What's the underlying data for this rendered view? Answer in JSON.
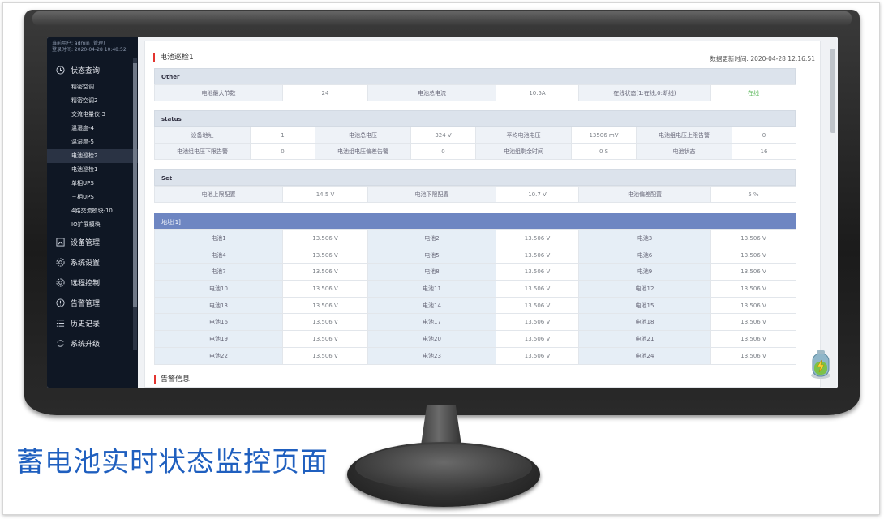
{
  "user": {
    "line1": "当前用户: admin (管理)",
    "line2": "登录时间: 2020-04-28 10:48:52"
  },
  "sidebar": {
    "sections": [
      {
        "label": "状态查询",
        "icon": "clock-icon"
      },
      {
        "label": "设备管理",
        "icon": "device-icon"
      },
      {
        "label": "系统设置",
        "icon": "settings-icon"
      },
      {
        "label": "远程控制",
        "icon": "remote-icon"
      },
      {
        "label": "告警管理",
        "icon": "alert-icon"
      },
      {
        "label": "历史记录",
        "icon": "list-icon"
      },
      {
        "label": "系统升级",
        "icon": "refresh-icon"
      }
    ],
    "items": [
      "精密空调",
      "精密空调2",
      "交流电量仪-3",
      "温湿度-4",
      "温湿度-5",
      "电池巡检2",
      "电池巡检1",
      "单相UPS",
      "三相UPS",
      "4路交流模块-10",
      "IO扩展模块"
    ],
    "active_index": 5
  },
  "page": {
    "title": "电池巡检1",
    "update_label": "数据更新时间: 2020-04-28 12:16:51",
    "alarm_title": "告警信息"
  },
  "other": {
    "header": "Other",
    "row": [
      "电池最大节数",
      "24",
      "电池总电流",
      "10.5A",
      "在线状态(1:在线,0:断线)",
      "在线"
    ]
  },
  "status": {
    "header": "status",
    "rows": [
      [
        "设备地址",
        "1",
        "电池总电压",
        "324 V",
        "平均电池电压",
        "13506 mV",
        "电池组电压上限告警",
        "0"
      ],
      [
        "电池组电压下限告警",
        "0",
        "电池组电压偏差告警",
        "0",
        "电池组剩余时间",
        "0 S",
        "电池状态",
        "16"
      ]
    ]
  },
  "set": {
    "header": "Set",
    "row": [
      "电池上限配置",
      "14.5 V",
      "电池下限配置",
      "10.7 V",
      "电池偏差配置",
      "5 %"
    ]
  },
  "address": {
    "header": "地址[1]",
    "rows": [
      [
        "电池1",
        "13.506 V",
        "电池2",
        "13.506 V",
        "电池3",
        "13.506 V"
      ],
      [
        "电池4",
        "13.506 V",
        "电池5",
        "13.506 V",
        "电池6",
        "13.506 V"
      ],
      [
        "电池7",
        "13.506 V",
        "电池8",
        "13.506 V",
        "电池9",
        "13.506 V"
      ],
      [
        "电池10",
        "13.506 V",
        "电池11",
        "13.506 V",
        "电池12",
        "13.506 V"
      ],
      [
        "电池13",
        "13.506 V",
        "电池14",
        "13.506 V",
        "电池15",
        "13.506 V"
      ],
      [
        "电池16",
        "13.506 V",
        "电池17",
        "13.506 V",
        "电池18",
        "13.506 V"
      ],
      [
        "电池19",
        "13.506 V",
        "电池20",
        "13.506 V",
        "电池21",
        "13.506 V"
      ],
      [
        "电池22",
        "13.506 V",
        "电池23",
        "13.506 V",
        "电池24",
        "13.506 V"
      ]
    ]
  },
  "caption": "蓄电池实时状态监控页面",
  "colors": {
    "accent": "#e3342f",
    "header_blue": "#6e86c2",
    "online_green": "#5cb85c",
    "caption_blue": "#1f5fbf"
  }
}
